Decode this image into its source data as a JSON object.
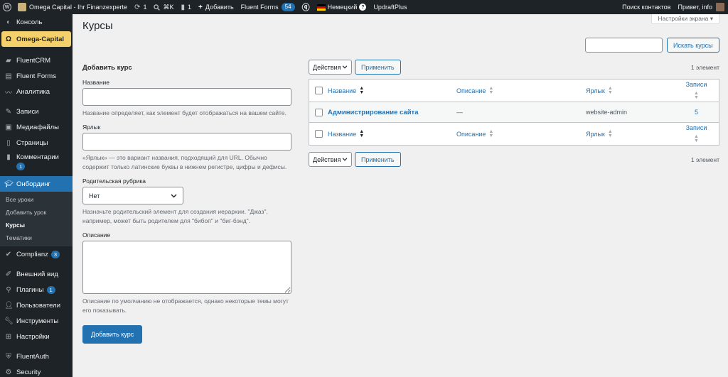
{
  "admin_bar": {
    "site_name": "Omega Capital - Ihr Finanzexperte",
    "updates_count": "1",
    "search_shortcut": "⌘K",
    "comments_count": "1",
    "new_label": "Добавить",
    "fluent_forms_label": "Fluent Forms",
    "fluent_forms_count": "54",
    "language_label": "Немецкий",
    "updraft_label": "UpdraftPlus",
    "contacts_search_label": "Поиск контактов",
    "greeting": "Привет, info"
  },
  "sidebar": {
    "items": [
      {
        "label": "Консоль",
        "icon": "dashboard-icon"
      },
      {
        "label": "Omega-Capital",
        "icon": "omega-icon"
      },
      {
        "label": "FluentCRM",
        "icon": "fluentcrm-icon"
      },
      {
        "label": "Fluent Forms",
        "icon": "forms-icon"
      },
      {
        "label": "Аналитика",
        "icon": "analytics-icon"
      },
      {
        "label": "Записи",
        "icon": "pin-icon"
      },
      {
        "label": "Медиафайлы",
        "icon": "media-icon"
      },
      {
        "label": "Страницы",
        "icon": "pages-icon"
      },
      {
        "label": "Комментарии",
        "icon": "comments-icon",
        "badge": "1"
      },
      {
        "label": "Онбординг",
        "icon": "graduation-cap-icon"
      },
      {
        "label": "Complianz",
        "icon": "complianz-icon",
        "badge": "3"
      },
      {
        "label": "Внешний вид",
        "icon": "appearance-icon"
      },
      {
        "label": "Плагины",
        "icon": "plugins-icon",
        "badge": "1"
      },
      {
        "label": "Пользователи",
        "icon": "users-icon"
      },
      {
        "label": "Инструменты",
        "icon": "tools-icon"
      },
      {
        "label": "Настройки",
        "icon": "settings-icon"
      },
      {
        "label": "FluentAuth",
        "icon": "fluentauth-icon"
      },
      {
        "label": "Security",
        "icon": "security-icon"
      }
    ],
    "submenu": [
      "Все уроки",
      "Добавить урок",
      "Курсы",
      "Тематики"
    ]
  },
  "screen_options_label": "Настройки экрана ▾",
  "page_title": "Курсы",
  "search": {
    "button_label": "Искать курсы",
    "value": ""
  },
  "form": {
    "heading": "Добавить курс",
    "name_label": "Название",
    "name_desc": "Название определяет, как элемент будет отображаться на вашем сайте.",
    "slug_label": "Ярлык",
    "slug_desc": "«Ярлык» — это вариант названия, подходящий для URL. Обычно содержит только латинские буквы в нижнем регистре, цифры и дефисы.",
    "parent_label": "Родительская рубрика",
    "parent_value": "Нет",
    "parent_desc": "Назначьте родительский элемент для создания иерархии. \"Джаз\", например, может быть родителем для \"бибоп\" и \"биг-бэнд\".",
    "description_label": "Описание",
    "description_desc": "Описание по умолчанию не отображается, однако некоторые темы могут его показывать.",
    "submit_label": "Добавить курс"
  },
  "table": {
    "bulk_label": "Действия",
    "apply_label": "Применить",
    "count_label": "1 элемент",
    "columns": {
      "name": "Название",
      "description": "Описание",
      "slug": "Ярлык",
      "count": "Записи"
    },
    "rows": [
      {
        "name": "Администрирование сайта",
        "description": "—",
        "slug": "website-admin",
        "count": "5"
      }
    ]
  }
}
